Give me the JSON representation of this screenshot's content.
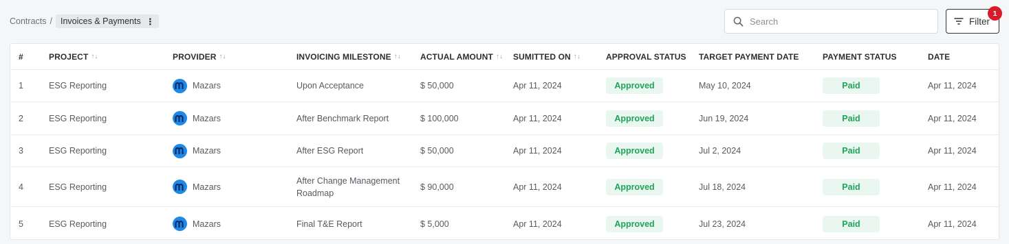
{
  "breadcrumb": {
    "parent": "Contracts",
    "separator": "/",
    "current": "Invoices & Payments",
    "menu_glyph": "⋮"
  },
  "search": {
    "placeholder": "Search",
    "value": ""
  },
  "filter": {
    "label": "Filter",
    "badge_count": "1"
  },
  "table": {
    "columns": {
      "num": "#",
      "project": "PROJECT",
      "provider": "PROVIDER",
      "milestone": "INVOICING MILESTONE",
      "amount": "ACTUAL AMOUNT",
      "submitted": "SUMITTED ON",
      "approval": "APPROVAL STATUS",
      "target": "TARGET PAYMENT DATE",
      "payment": "PAYMENT STATUS",
      "date": "DATE"
    },
    "sort_glyph": "↑↓",
    "rows": [
      {
        "num": "1",
        "project": "ESG Reporting",
        "provider": "Mazars",
        "milestone": "Upon Acceptance",
        "amount": "$ 50,000",
        "submitted": "Apr 11, 2024",
        "approval": "Approved",
        "target": "May 10, 2024",
        "payment": "Paid",
        "date": "Apr 11, 2024"
      },
      {
        "num": "2",
        "project": "ESG Reporting",
        "provider": "Mazars",
        "milestone": "After Benchmark Report",
        "amount": "$ 100,000",
        "submitted": "Apr 11, 2024",
        "approval": "Approved",
        "target": "Jun 19, 2024",
        "payment": "Paid",
        "date": "Apr 11, 2024"
      },
      {
        "num": "3",
        "project": "ESG Reporting",
        "provider": "Mazars",
        "milestone": "After ESG Report",
        "amount": "$ 50,000",
        "submitted": "Apr 11, 2024",
        "approval": "Approved",
        "target": "Jul 2, 2024",
        "payment": "Paid",
        "date": "Apr 11, 2024"
      },
      {
        "num": "4",
        "project": "ESG Reporting",
        "provider": "Mazars",
        "milestone": "After Change Management Roadmap",
        "amount": "$ 90,000",
        "submitted": "Apr 11, 2024",
        "approval": "Approved",
        "target": "Jul 18, 2024",
        "payment": "Paid",
        "date": "Apr 11, 2024"
      },
      {
        "num": "5",
        "project": "ESG Reporting",
        "provider": "Mazars",
        "milestone": "Final T&E Report",
        "amount": "$ 5,000",
        "submitted": "Apr 11, 2024",
        "approval": "Approved",
        "target": "Jul 23, 2024",
        "payment": "Paid",
        "date": "Apr 11, 2024"
      }
    ]
  },
  "colors": {
    "accent": "#1e88e5",
    "status_green": "#1ea45a",
    "status_bg": "#eaf7f0",
    "badge_red": "#d81b2a"
  },
  "icons": {
    "search": "search-icon",
    "filter": "filter-icon",
    "provider_logo": "mazars-logo-icon",
    "sort": "sort-icon",
    "more": "more-vertical-icon"
  }
}
